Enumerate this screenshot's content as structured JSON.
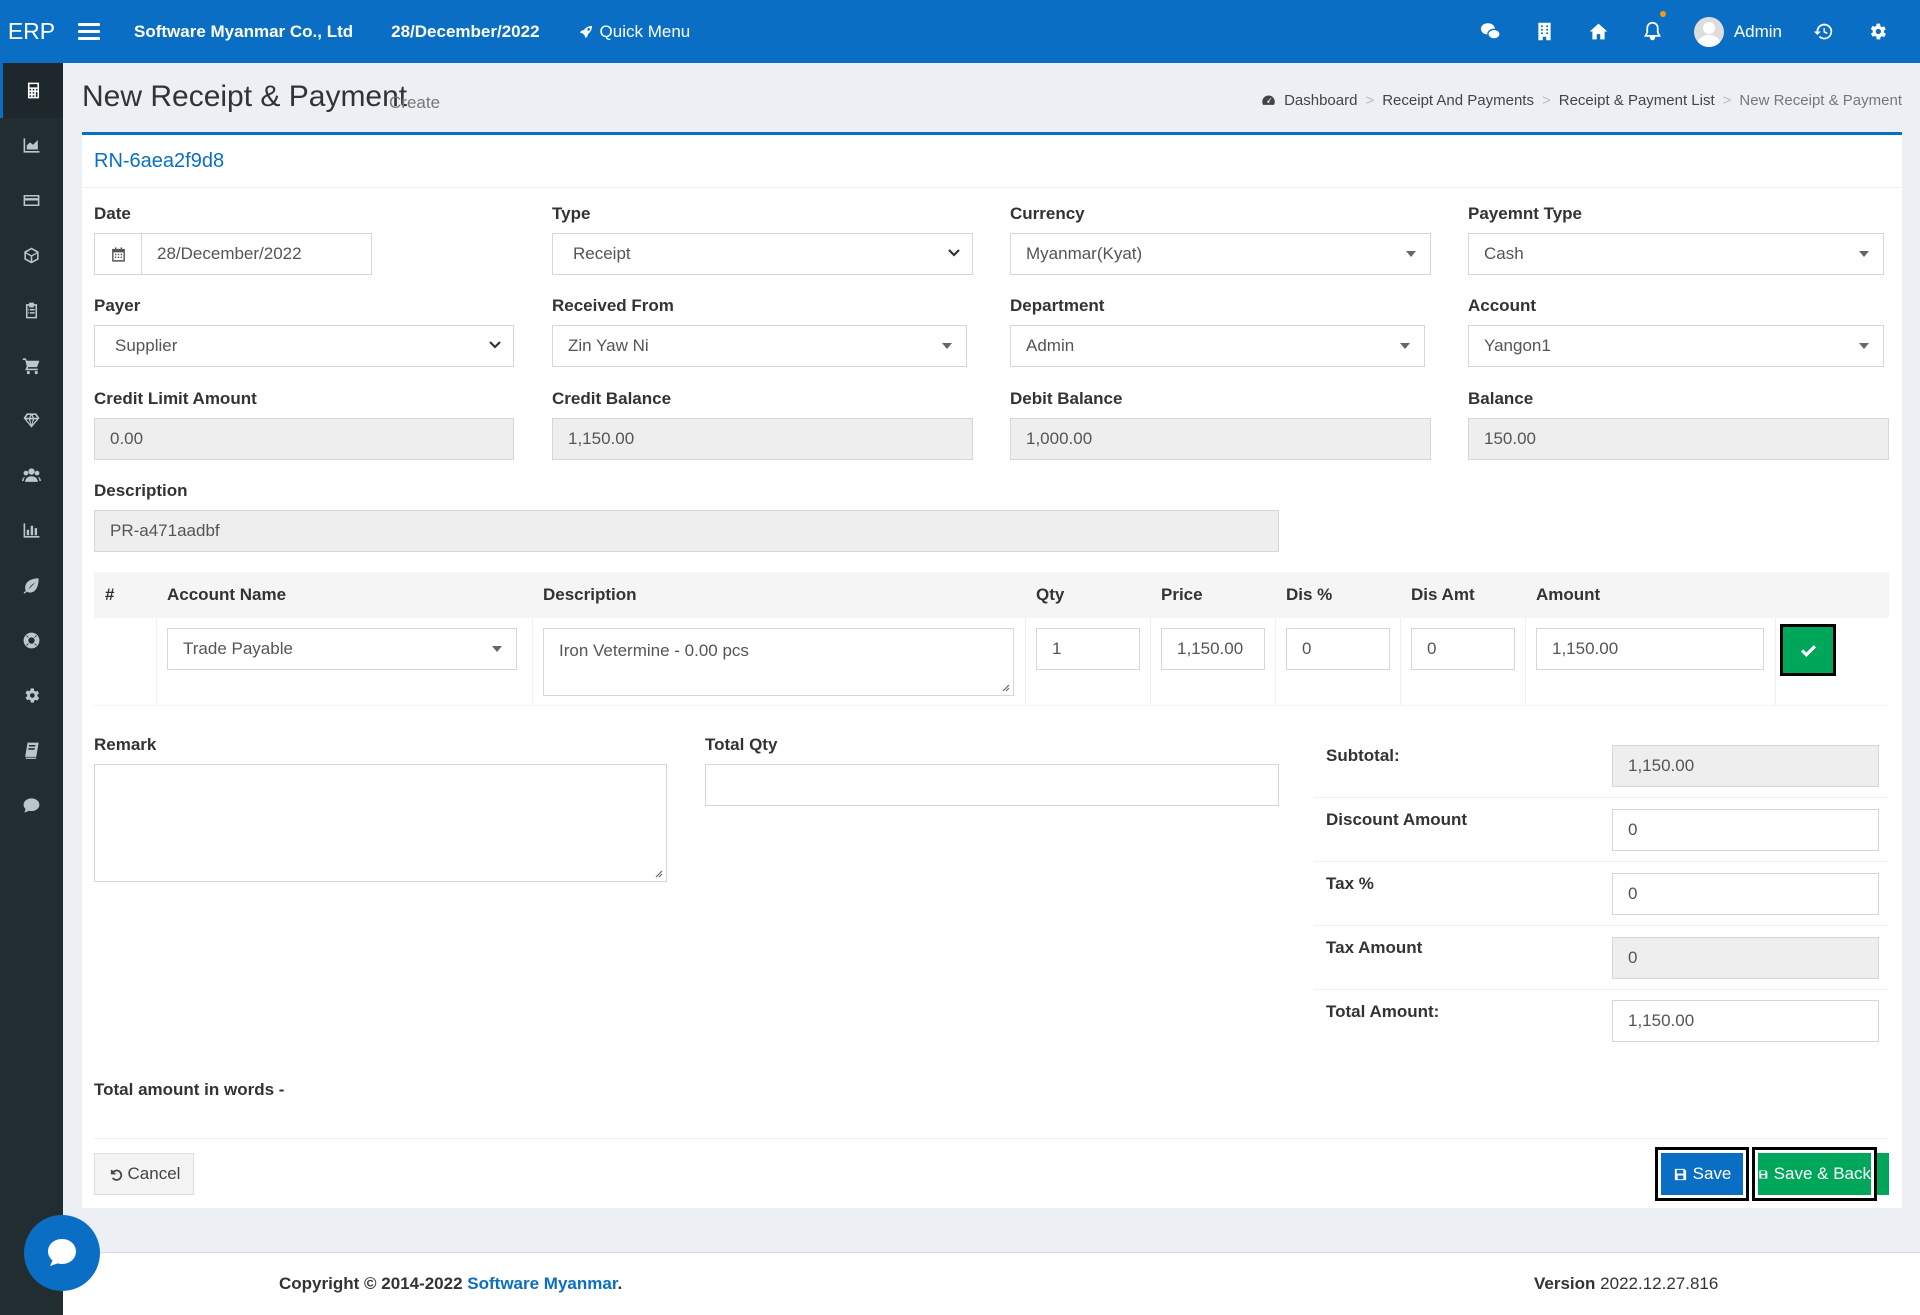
{
  "topbar": {
    "logo": "ERP",
    "company": "Software Myanmar Co., Ltd",
    "date": "28/December/2022",
    "quick_menu": "Quick Menu",
    "user": "Admin"
  },
  "sidebar": {
    "icons": [
      "calculator-icon",
      "area-chart-icon",
      "credit-card-icon",
      "cube-icon",
      "clipboard-icon",
      "cart-icon",
      "diamond-icon",
      "users-icon",
      "bar-chart-icon",
      "leaf-icon",
      "life-ring-icon",
      "gear-icon",
      "book-icon",
      "comment-icon"
    ]
  },
  "header": {
    "title": "New Receipt & Payment",
    "subtitle": "Create",
    "breadcrumb": [
      "Dashboard",
      "Receipt And Payments",
      "Receipt & Payment List",
      "New Receipt & Payment"
    ]
  },
  "form": {
    "rn": "RN-6aea2f9d8",
    "date_label": "Date",
    "date_value": "28/December/2022",
    "type_label": "Type",
    "type_value": "Receipt",
    "currency_label": "Currency",
    "currency_value": "Myanmar(Kyat)",
    "payment_type_label": "Payemnt Type",
    "payment_type_value": "Cash",
    "payer_label": "Payer",
    "payer_value": "Supplier",
    "received_from_label": "Received From",
    "received_from_value": "Zin Yaw Ni",
    "department_label": "Department",
    "department_value": "Admin",
    "account_label": "Account",
    "account_value": "Yangon1",
    "credit_limit_label": "Credit Limit Amount",
    "credit_limit_value": "0.00",
    "credit_balance_label": "Credit Balance",
    "credit_balance_value": "1,150.00",
    "debit_balance_label": "Debit Balance",
    "debit_balance_value": "1,000.00",
    "balance_label": "Balance",
    "balance_value": "150.00",
    "description_label": "Description",
    "description_value": "PR-a471aadbf"
  },
  "table": {
    "headers": [
      "#",
      "Account Name",
      "Description",
      "Qty",
      "Price",
      "Dis %",
      "Dis Amt",
      "Amount"
    ],
    "row": {
      "account_name": "Trade Payable",
      "description": "Iron Vetermine - 0.00 pcs",
      "qty": "1",
      "price": "1,150.00",
      "dis_pct": "0",
      "dis_amt": "0",
      "amount": "1,150.00"
    }
  },
  "bottom": {
    "remark_label": "Remark",
    "total_qty_label": "Total Qty",
    "subtotal_label": "Subtotal:",
    "subtotal_value": "1,150.00",
    "discount_label": "Discount Amount",
    "discount_value": "0",
    "tax_pct_label": "Tax %",
    "tax_pct_value": "0",
    "tax_amount_label": "Tax Amount",
    "tax_amount_value": "0",
    "total_label": "Total Amount:",
    "total_value": "1,150.00",
    "words_label": "Total amount in words -"
  },
  "actions": {
    "cancel": "Cancel",
    "save": "Save",
    "save_back": "Save & Back"
  },
  "footer": {
    "copyright_prefix": "Copyright © 2014-2022",
    "company_link": "Software Myanmar",
    "period": ".",
    "version_label": "Version",
    "version_value": "2022.12.27.816"
  },
  "colors": {
    "primary": "#0a6fc4",
    "success": "#00a65a",
    "sidebar": "#222d32"
  }
}
